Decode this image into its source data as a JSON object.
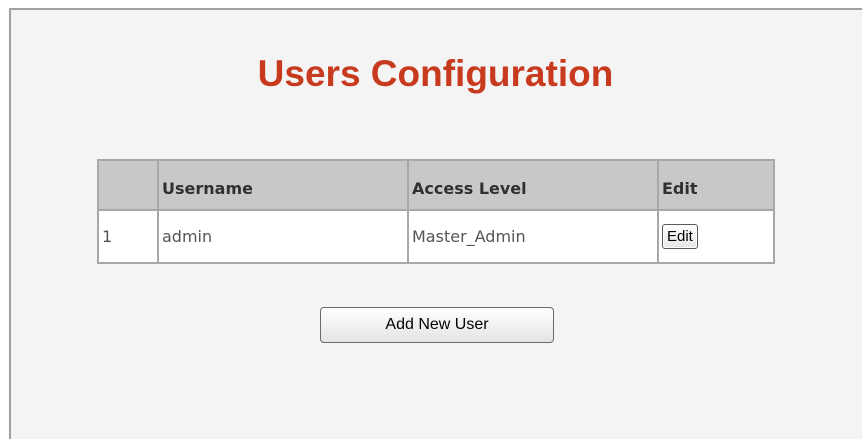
{
  "page": {
    "title": "Users Configuration"
  },
  "users_table": {
    "headers": {
      "index": "",
      "username": "Username",
      "access_level": "Access Level",
      "edit": "Edit"
    },
    "rows": [
      {
        "index": "1",
        "username": "admin",
        "access_level": "Master_Admin",
        "edit_label": "Edit"
      }
    ]
  },
  "actions": {
    "add_user_label": "Add New User"
  }
}
